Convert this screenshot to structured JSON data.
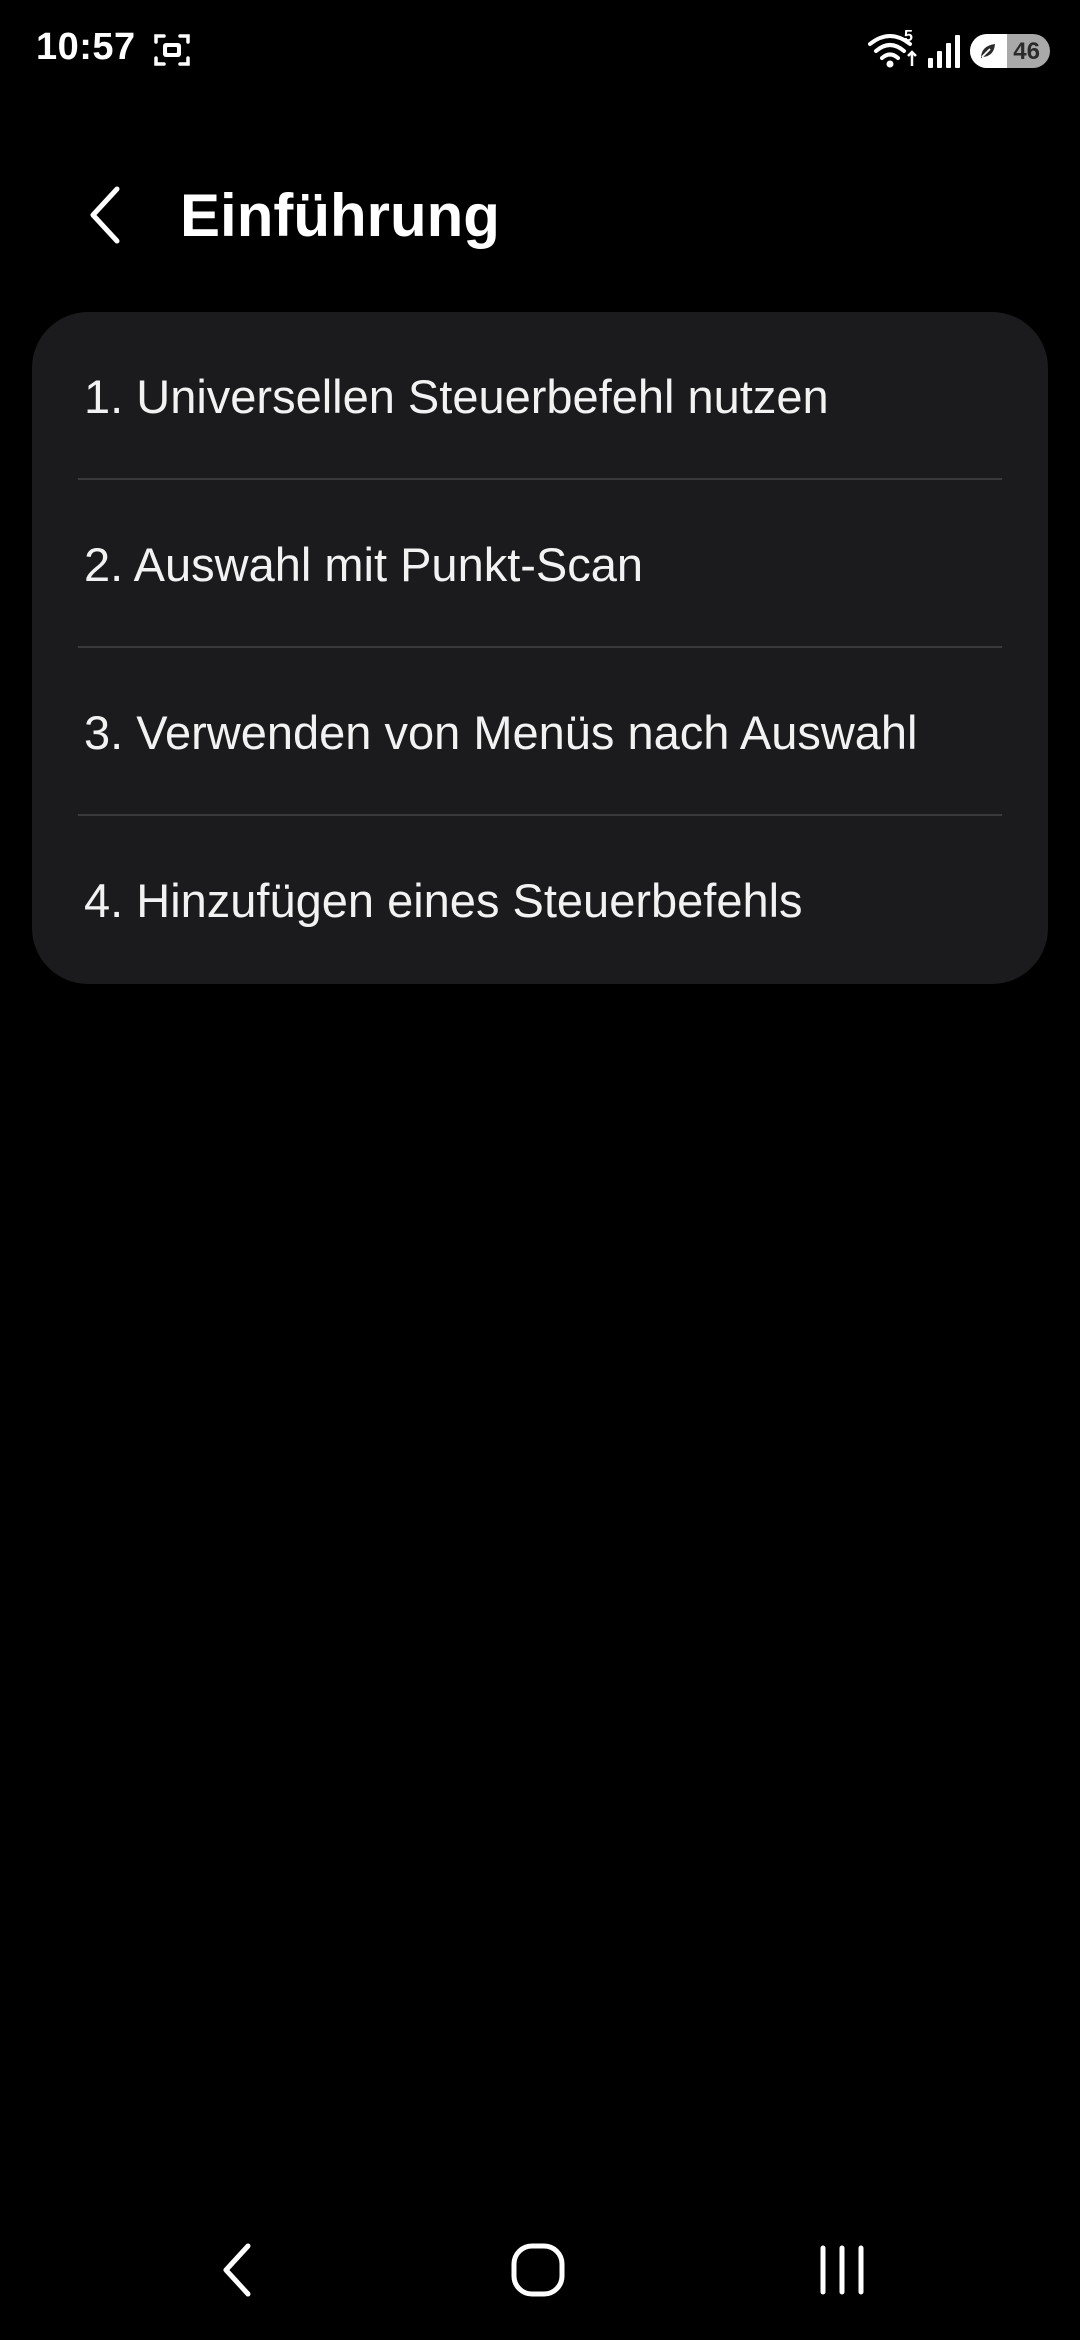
{
  "status_bar": {
    "time": "10:57",
    "wifi_badge": "5",
    "battery_level": "46",
    "battery_percent": 46,
    "icons": [
      "screen-record-icon",
      "wifi-icon",
      "signal-icon",
      "battery-saver-icon"
    ]
  },
  "header": {
    "title": "Einführung",
    "back_icon": "chevron-left-icon"
  },
  "list": {
    "items": [
      {
        "label": "1. Universellen Steuerbefehl nutzen"
      },
      {
        "label": "2. Auswahl mit Punkt-Scan"
      },
      {
        "label": "3. Verwenden von Menüs nach Auswahl"
      },
      {
        "label": "4. Hinzufügen eines Steuerbefehls"
      }
    ]
  },
  "nav_bar": {
    "icons": [
      "nav-back-icon",
      "nav-home-icon",
      "nav-recents-icon"
    ]
  },
  "colors": {
    "background": "#000000",
    "card": "#1b1b1d",
    "divider": "#3a3a3c",
    "text": "#ffffff"
  }
}
